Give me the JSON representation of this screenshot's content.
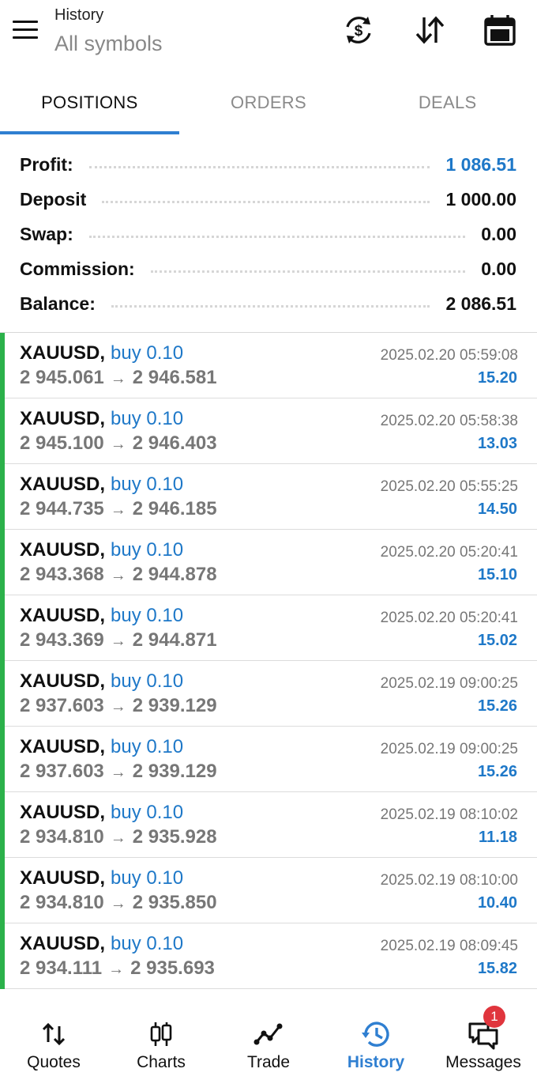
{
  "header": {
    "title": "History",
    "subtitle": "All symbols"
  },
  "tabs": [
    {
      "label": "POSITIONS",
      "active": true
    },
    {
      "label": "ORDERS",
      "active": false
    },
    {
      "label": "DEALS",
      "active": false
    }
  ],
  "summary": [
    {
      "label": "Profit:",
      "value": "1 086.51",
      "highlight": true
    },
    {
      "label": "Deposit",
      "value": "1 000.00",
      "highlight": false
    },
    {
      "label": "Swap:",
      "value": "0.00",
      "highlight": false
    },
    {
      "label": "Commission:",
      "value": "0.00",
      "highlight": false
    },
    {
      "label": "Balance:",
      "value": "2 086.51",
      "highlight": false
    }
  ],
  "positions": [
    {
      "symbol": "XAUUSD,",
      "side": "buy 0.10",
      "open": "2 945.061",
      "close": "2 946.581",
      "arrow": "→",
      "time": "2025.02.20 05:59:08",
      "profit": "15.20"
    },
    {
      "symbol": "XAUUSD,",
      "side": "buy 0.10",
      "open": "2 945.100",
      "close": "2 946.403",
      "arrow": "→",
      "time": "2025.02.20 05:58:38",
      "profit": "13.03"
    },
    {
      "symbol": "XAUUSD,",
      "side": "buy 0.10",
      "open": "2 944.735",
      "close": "2 946.185",
      "arrow": "→",
      "time": "2025.02.20 05:55:25",
      "profit": "14.50"
    },
    {
      "symbol": "XAUUSD,",
      "side": "buy 0.10",
      "open": "2 943.368",
      "close": "2 944.878",
      "arrow": "→",
      "time": "2025.02.20 05:20:41",
      "profit": "15.10"
    },
    {
      "symbol": "XAUUSD,",
      "side": "buy 0.10",
      "open": "2 943.369",
      "close": "2 944.871",
      "arrow": "→",
      "time": "2025.02.20 05:20:41",
      "profit": "15.02"
    },
    {
      "symbol": "XAUUSD,",
      "side": "buy 0.10",
      "open": "2 937.603",
      "close": "2 939.129",
      "arrow": "→",
      "time": "2025.02.19 09:00:25",
      "profit": "15.26"
    },
    {
      "symbol": "XAUUSD,",
      "side": "buy 0.10",
      "open": "2 937.603",
      "close": "2 939.129",
      "arrow": "→",
      "time": "2025.02.19 09:00:25",
      "profit": "15.26"
    },
    {
      "symbol": "XAUUSD,",
      "side": "buy 0.10",
      "open": "2 934.810",
      "close": "2 935.928",
      "arrow": "→",
      "time": "2025.02.19 08:10:02",
      "profit": "11.18"
    },
    {
      "symbol": "XAUUSD,",
      "side": "buy 0.10",
      "open": "2 934.810",
      "close": "2 935.850",
      "arrow": "→",
      "time": "2025.02.19 08:10:00",
      "profit": "10.40"
    },
    {
      "symbol": "XAUUSD,",
      "side": "buy 0.10",
      "open": "2 934.111",
      "close": "2 935.693",
      "arrow": "→",
      "time": "2025.02.19 08:09:45",
      "profit": "15.82"
    }
  ],
  "nav": [
    {
      "label": "Quotes",
      "icon": "quotes-icon",
      "active": false
    },
    {
      "label": "Charts",
      "icon": "charts-icon",
      "active": false
    },
    {
      "label": "Trade",
      "icon": "trade-icon",
      "active": false
    },
    {
      "label": "History",
      "icon": "history-icon",
      "active": true
    },
    {
      "label": "Messages",
      "icon": "messages-icon",
      "active": false
    }
  ],
  "messages_badge": "1",
  "colors": {
    "accent": "#2f7fd1",
    "profit_blue": "#1e78c8",
    "buy_bar": "#2bb14a",
    "badge": "#e0353d"
  }
}
